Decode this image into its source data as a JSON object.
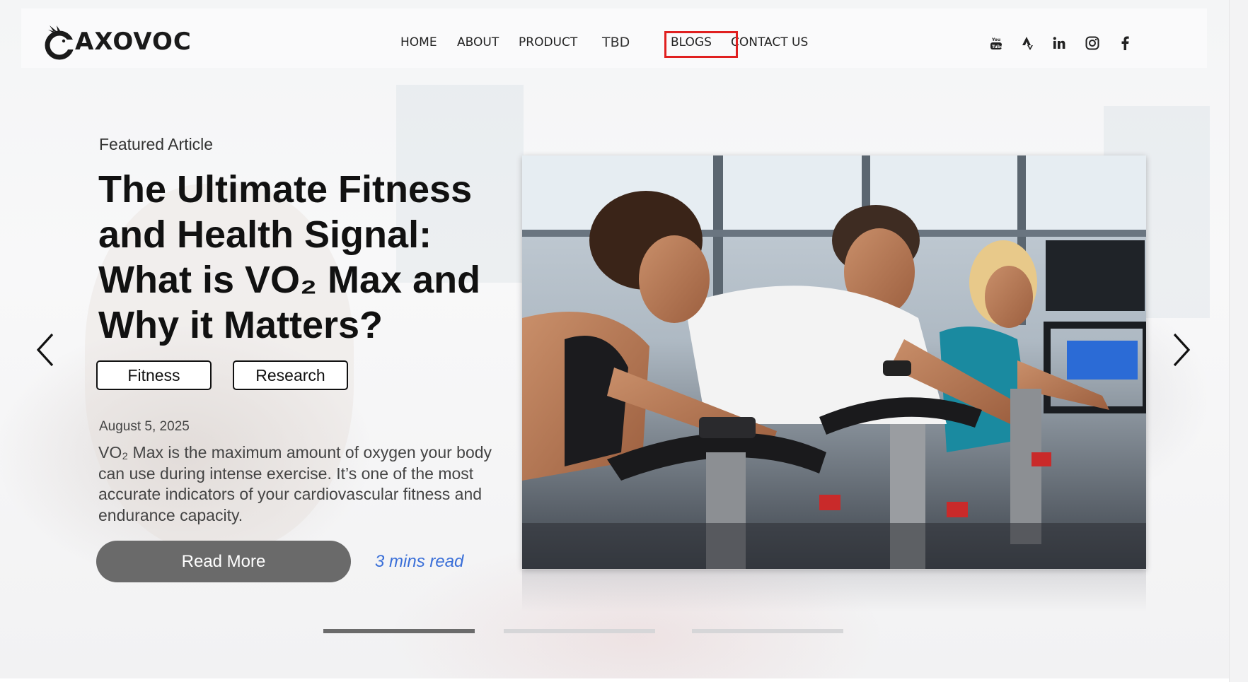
{
  "brand": {
    "name": "AXOVOC"
  },
  "nav": {
    "items": [
      {
        "label": "HOME"
      },
      {
        "label": "ABOUT"
      },
      {
        "label": "PRODUCT"
      },
      {
        "label": "TBD"
      },
      {
        "label": "BLOGS"
      },
      {
        "label": "CONTACT US"
      }
    ],
    "active": "BLOGS"
  },
  "social": [
    "youtube-icon",
    "strava-icon",
    "linkedin-icon",
    "instagram-icon",
    "facebook-icon"
  ],
  "article": {
    "eyebrow": "Featured Article",
    "title": "The Ultimate Fitness and Health Signal: What is VO₂ Max and Why it Matters?",
    "tags": [
      "Fitness",
      "Research"
    ],
    "date": "August 5, 2025",
    "excerpt": "VO₂ Max is the maximum amount of oxygen your body can use during intense exercise. It’s one of the most accurate indicators of your cardiovascular fitness and endurance capacity.",
    "cta": "Read More",
    "read_time": "3 mins read"
  },
  "carousel": {
    "slides": 3,
    "active_slide": 1
  },
  "colors": {
    "accent_link": "#3a6fd8",
    "button_bg": "#6a6a6a",
    "highlight": "#e02020"
  }
}
